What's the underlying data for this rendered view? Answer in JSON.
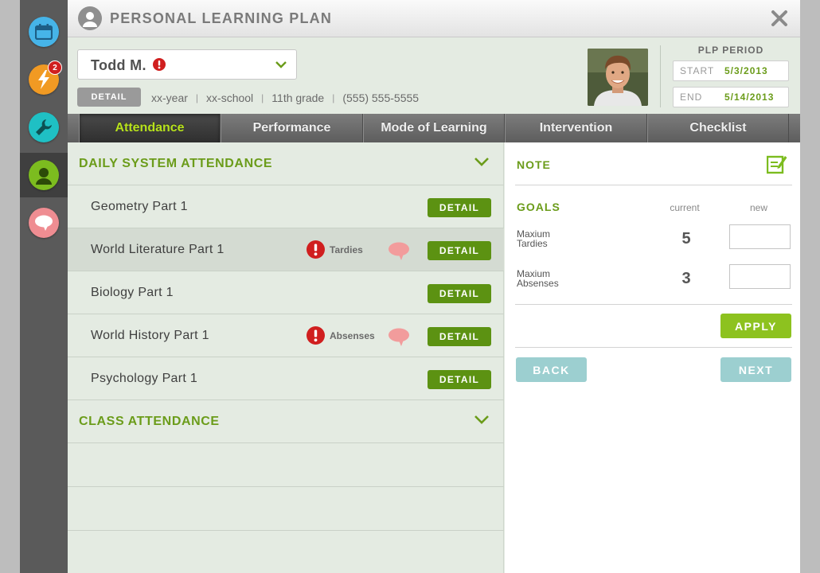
{
  "window": {
    "title": "PERSONAL LEARNING PLAN"
  },
  "sidebar": {
    "items": [
      {
        "name": "calendar",
        "color": "#46b4e8",
        "badge": ""
      },
      {
        "name": "alerts",
        "color": "#f19a23",
        "badge": "2"
      },
      {
        "name": "tools",
        "color": "#1fc0c4",
        "badge": ""
      },
      {
        "name": "profile",
        "color": "#7cbc1f",
        "badge": "",
        "active": true
      },
      {
        "name": "messages",
        "color": "#ef8d92",
        "badge": ""
      }
    ]
  },
  "student": {
    "name": "Todd M.",
    "detail_label": "DETAIL",
    "year": "xx-year",
    "school": "xx-school",
    "grade": "11th grade",
    "phone": "(555) 555-5555"
  },
  "period": {
    "title": "PLP PERIOD",
    "start_label": "START",
    "start": "5/3/2013",
    "end_label": "END",
    "end": "5/14/2013"
  },
  "tabs": [
    "Attendance",
    "Performance",
    "Mode of Learning",
    "Intervention",
    "Checklist"
  ],
  "attendance": {
    "daily_title": "DAILY SYSTEM ATTENDANCE",
    "class_title": "CLASS ATTENDANCE",
    "detail_label": "DETAIL",
    "courses": [
      {
        "name": "Geometry Part 1",
        "flag": ""
      },
      {
        "name": "World Literature Part 1",
        "flag": "Tardies"
      },
      {
        "name": "Biology Part 1",
        "flag": ""
      },
      {
        "name": "World History Part 1",
        "flag": "Absenses"
      },
      {
        "name": "Psychology Part 1",
        "flag": ""
      }
    ]
  },
  "note": {
    "title": "NOTE"
  },
  "goals": {
    "title": "GOALS",
    "current_label": "current",
    "new_label": "new",
    "rows": [
      {
        "label_line1": "Maxium",
        "label_line2": "Tardies",
        "current": "5",
        "new": ""
      },
      {
        "label_line1": "Maxium",
        "label_line2": "Absenses",
        "current": "3",
        "new": ""
      }
    ]
  },
  "buttons": {
    "apply": "APPLY",
    "back": "BACK",
    "next": "NEXT"
  },
  "colors": {
    "accent_green": "#6b9c1a",
    "button_green": "#5c9212",
    "apply_green": "#8dc21f",
    "teal_button": "#9ccfd0",
    "alert_red": "#d01f1f",
    "comment_pink": "#f29c9c"
  }
}
